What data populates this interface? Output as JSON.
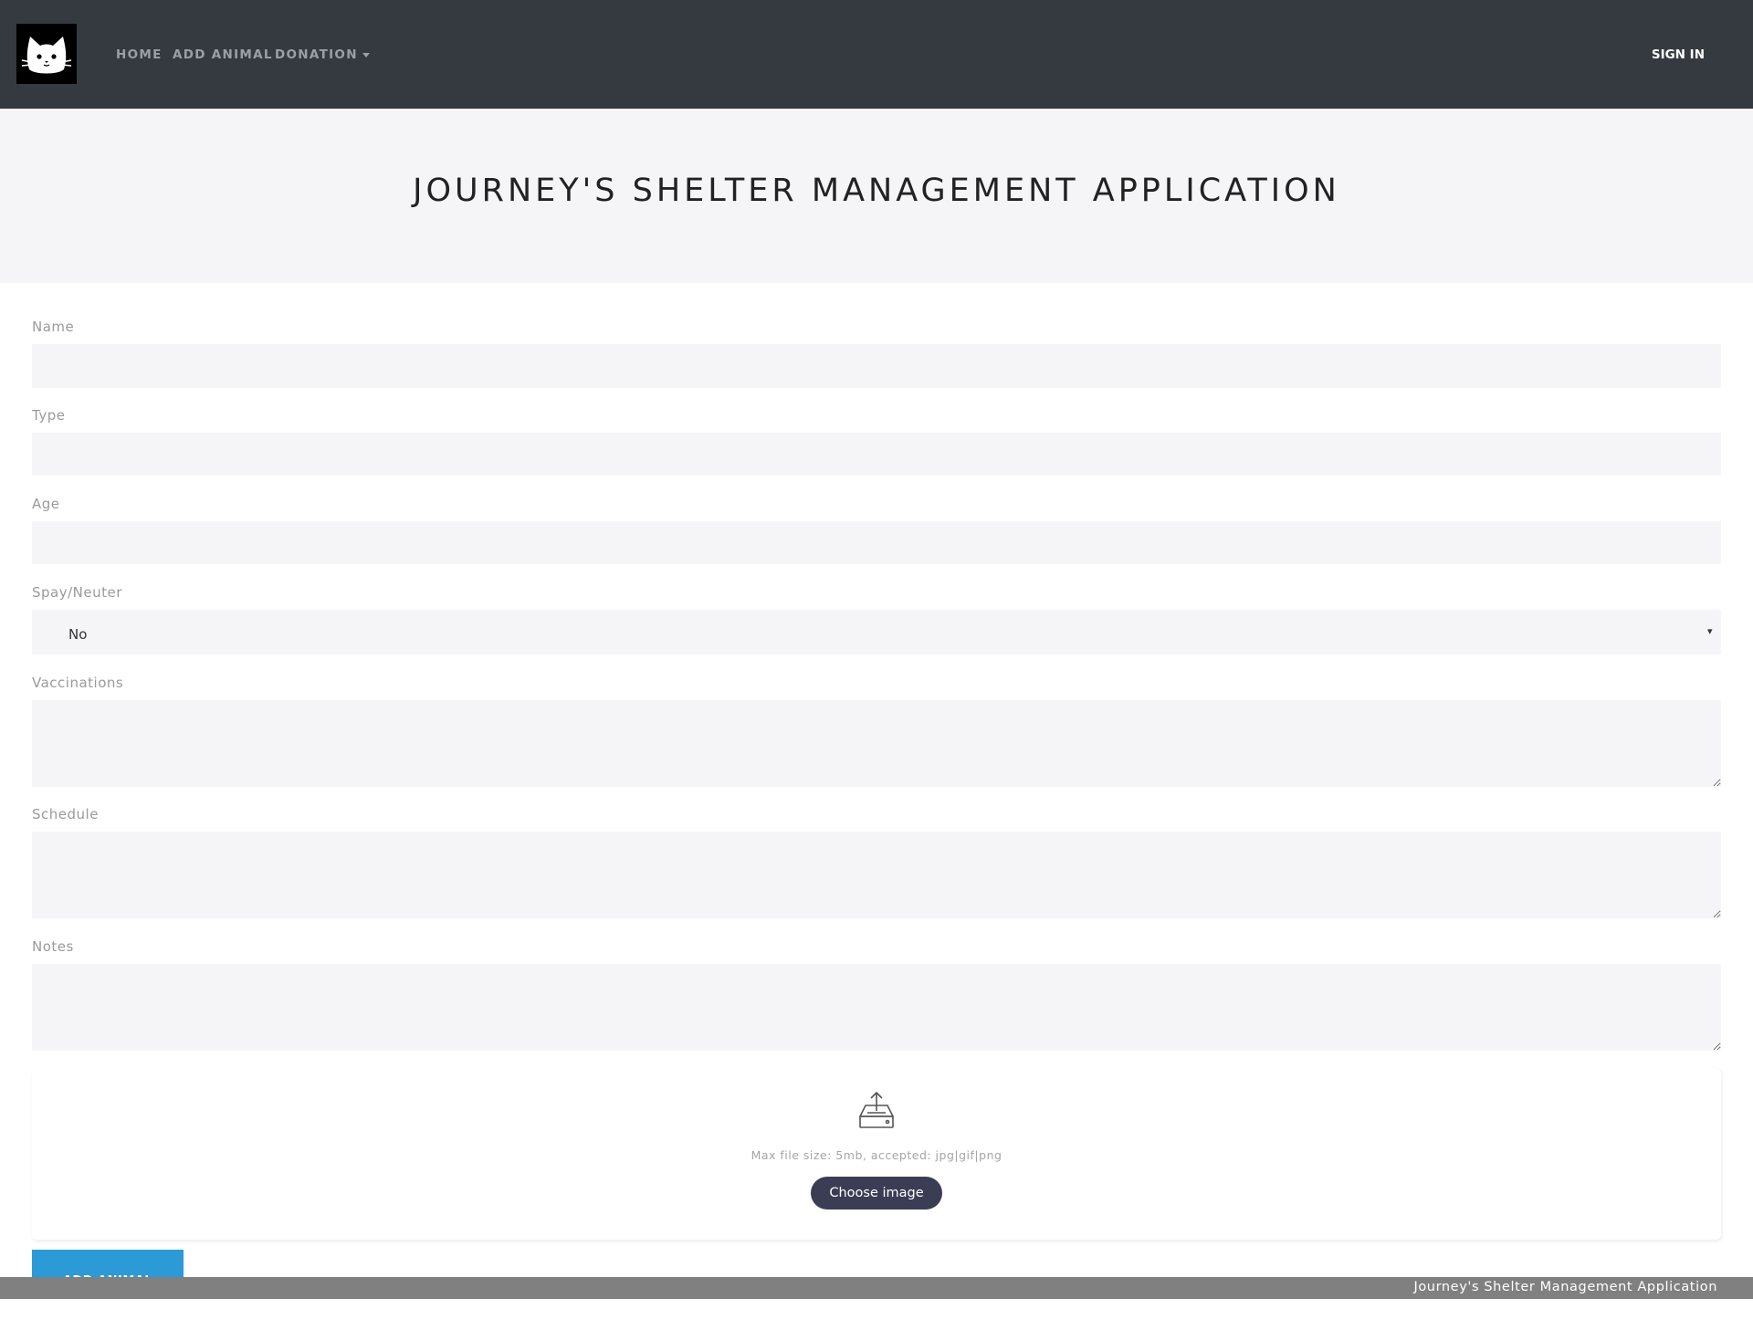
{
  "nav": {
    "logo_icon": "cat-face-icon",
    "home": "HOME",
    "add_animal": "ADD ANIMAL",
    "donation": "DONATION",
    "sign_in": "SIGN IN"
  },
  "hero": {
    "title": "JOURNEY'S SHELTER MANAGEMENT APPLICATION"
  },
  "form": {
    "name_label": "Name",
    "name_value": "",
    "type_label": "Type",
    "type_value": "",
    "age_label": "Age",
    "age_value": "",
    "spay_label": "Spay/Neuter",
    "spay_value": "No",
    "vaccinations_label": "Vaccinations",
    "vaccinations_value": "",
    "schedule_label": "Schedule",
    "schedule_value": "",
    "notes_label": "Notes",
    "notes_value": ""
  },
  "upload": {
    "icon": "upload-tray-icon",
    "hint": "Max file size: 5mb, accepted: jpg|gif|png",
    "button": "Choose image"
  },
  "submit": {
    "label": "ADD ANIMAL"
  },
  "footer": {
    "text": "Journey's Shelter Management Application"
  },
  "colors": {
    "navbar_bg": "#343a40",
    "hero_bg": "#f5f5f7",
    "submit_bg": "#2b9ad6",
    "choose_btn_bg": "#3b3d55",
    "footer_bg": "#808080"
  }
}
